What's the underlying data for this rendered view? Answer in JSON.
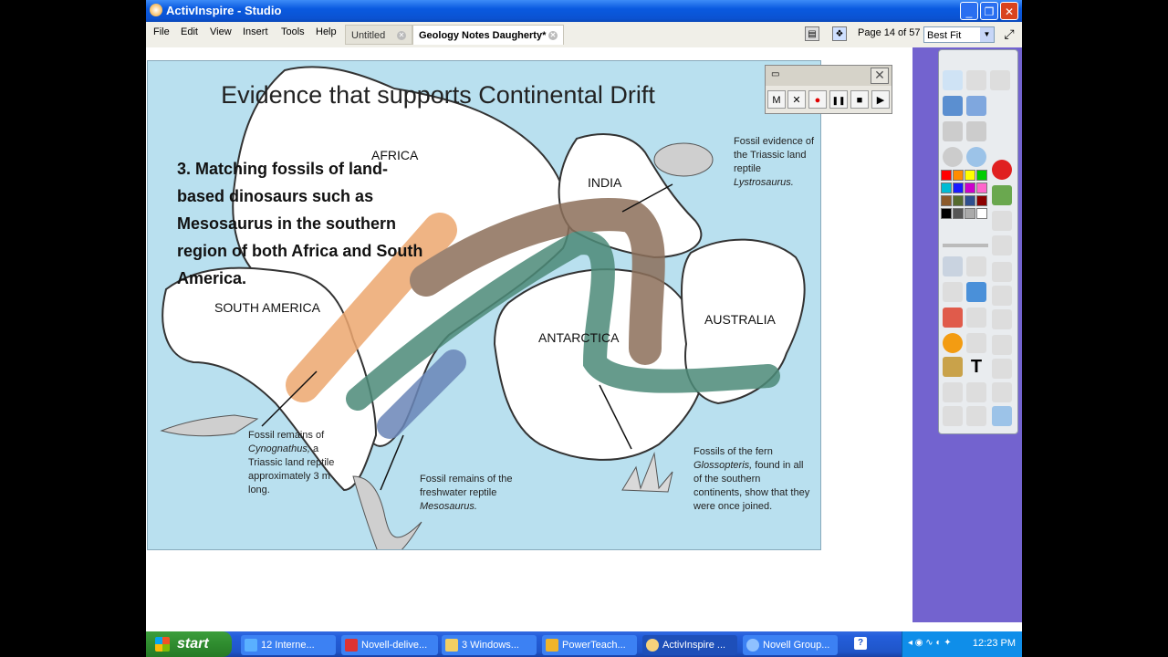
{
  "window": {
    "title": "ActivInspire - Studio"
  },
  "menu": [
    "File",
    "Edit",
    "View",
    "Insert",
    "Tools",
    "Help"
  ],
  "tabs": [
    {
      "label": "Untitled"
    },
    {
      "label": "Geology Notes Daugherty*"
    }
  ],
  "page_indicator": "Page 14 of 57",
  "zoom": "Best Fit",
  "slide": {
    "title": "Evidence that supports Continental Drift",
    "body": "3.  Matching fossils of land-based dinosaurs such as Mesosaurus in the southern region of both Africa and South America."
  },
  "map": {
    "labels": {
      "africa": "AFRICA",
      "india": "INDIA",
      "south_america": "SOUTH AMERICA",
      "antarctica": "ANTARCTICA",
      "australia": "AUSTRALIA"
    },
    "captions": {
      "lystrosaurus_pre": "Fossil evidence of the Triassic land reptile",
      "lystrosaurus_name": "Lystrosaurus.",
      "cynognathus_pre": "Fossil remains of",
      "cynognathus_name": "Cynognathus,",
      "cynognathus_post": "a Triassic land reptile approximately 3 m long.",
      "mesosaurus_pre": "Fossil remains of the freshwater reptile",
      "mesosaurus_name": "Mesosaurus.",
      "glossopteris_pre": "Fossils of the fern",
      "glossopteris_name": "Glossopteris,",
      "glossopteris_post": "found in all of the southern continents, show that they were once joined."
    }
  },
  "recorder": {
    "buttons": [
      "M",
      "✕",
      "●",
      "❚❚",
      "■",
      "▶"
    ]
  },
  "taskbar": {
    "start": "start",
    "items": [
      "12 Interne...",
      "Novell-delive...",
      "3 Windows...",
      "PowerTeach...",
      "ActivInspire ...",
      "Novell Group..."
    ],
    "clock": "12:23 PM"
  },
  "colors": {
    "ocean": "#b9e0ef",
    "orange_band": "#eda76f",
    "brown_band": "#8c6f5a",
    "green_band": "#4c8a78",
    "blue_band": "#6a86b8",
    "panel": "#7363cf"
  }
}
